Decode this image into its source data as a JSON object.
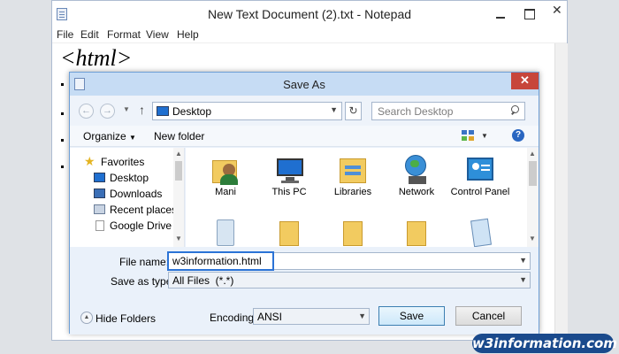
{
  "notepad": {
    "title": "New Text Document (2).txt - Notepad",
    "menu": [
      "File",
      "Edit",
      "Format",
      "View",
      "Help"
    ],
    "content": "<html>"
  },
  "dialog": {
    "title": "Save As",
    "address": "Desktop",
    "search_placeholder": "Search Desktop",
    "toolbar": {
      "organize": "Organize",
      "new_folder": "New folder"
    },
    "nav_items": [
      {
        "label": "Favorites",
        "icon": "star-icon"
      },
      {
        "label": "Desktop",
        "icon": "desktop-icon"
      },
      {
        "label": "Downloads",
        "icon": "downloads-icon"
      },
      {
        "label": "Recent places",
        "icon": "recent-places-icon"
      },
      {
        "label": "Google Drive",
        "icon": "google-drive-icon"
      }
    ],
    "files": [
      {
        "label": "Mani",
        "icon": "user-folder-icon"
      },
      {
        "label": "This PC",
        "icon": "computer-icon"
      },
      {
        "label": "Libraries",
        "icon": "libraries-icon"
      },
      {
        "label": "Network",
        "icon": "network-icon"
      },
      {
        "label": "Control Panel",
        "icon": "control-panel-icon"
      },
      {
        "label": "",
        "icon": "recycle-bin-icon"
      },
      {
        "label": "",
        "icon": "folder-icon"
      },
      {
        "label": "",
        "icon": "folder-icon"
      },
      {
        "label": "",
        "icon": "folder-icon"
      },
      {
        "label": "",
        "icon": "notepad-file-icon"
      }
    ],
    "file_name_label": "File name:",
    "file_name_value": "w3information.html",
    "save_type_label": "Save as type:",
    "save_type_value": "All Files  (*.*)",
    "hide_folders": "Hide Folders",
    "encoding_label": "Encoding:",
    "encoding_value": "ANSI",
    "save_button": "Save",
    "cancel_button": "Cancel",
    "colors": {
      "titlebar": "#c6dcf4",
      "close": "#c7463a",
      "focus": "#2b73d6"
    }
  },
  "watermark": "w3information.com"
}
